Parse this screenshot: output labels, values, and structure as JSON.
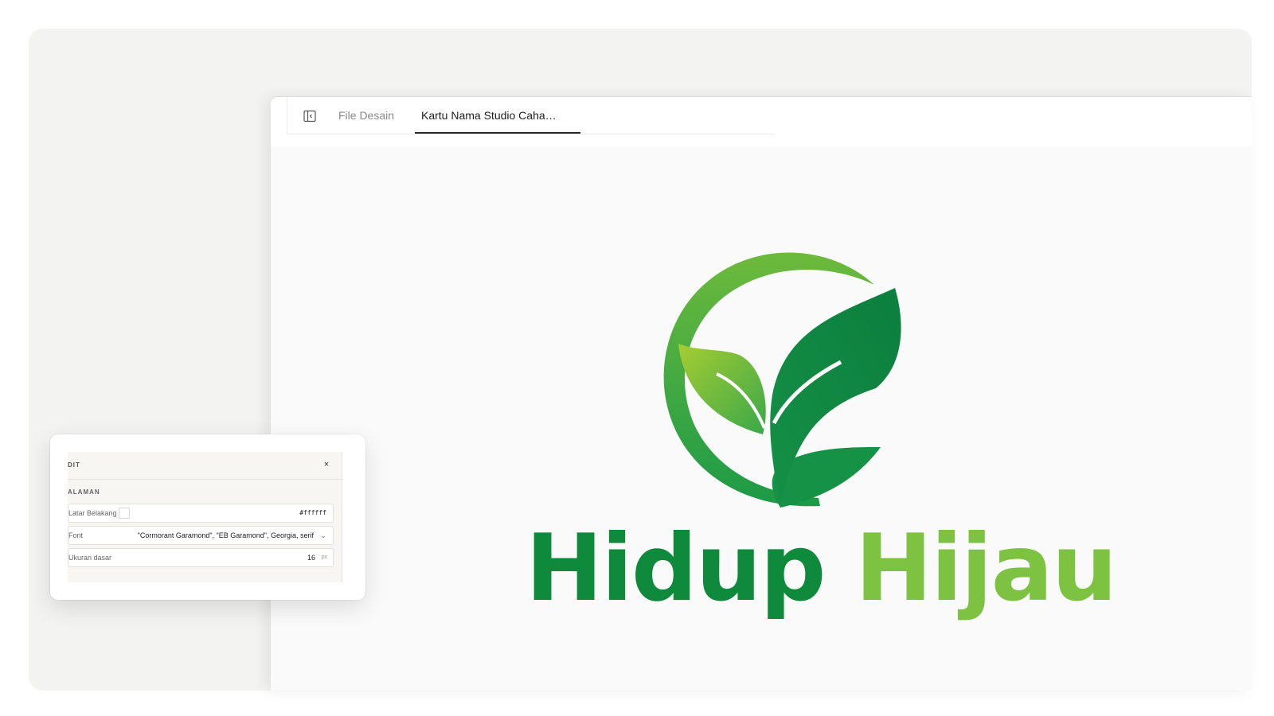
{
  "tabs": {
    "file_label": "File Desain",
    "active_label": "Kartu Nama Studio Caha…"
  },
  "icons": {
    "sidebar_toggle": "sidebar-toggle-icon",
    "close": "close-icon",
    "chevron": "chevron-down-icon"
  },
  "logo": {
    "word1": "Hidup",
    "word2": "Hijau",
    "colors": {
      "dark_green": "#0f8a3c",
      "light_green": "#7ec242"
    }
  },
  "panel": {
    "title": "DIT",
    "close_glyph": "×",
    "section": "ALAMAN",
    "background": {
      "label": "Latar Belakang",
      "value": "#ffffff"
    },
    "font": {
      "label": "Font",
      "value": "\"Cormorant Garamond\", \"EB Garamond\", Georgia, serif",
      "chevron": "⌄"
    },
    "base_size": {
      "label": "Ukuran dasar",
      "value": "16",
      "unit": "px"
    }
  }
}
